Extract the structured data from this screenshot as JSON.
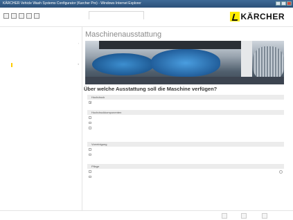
{
  "window": {
    "title": "KÄRCHER Vehicle Wash Systems Configurator (Karcher Pro) - Windows Internet Explorer"
  },
  "toolbar": {
    "tab_label": ""
  },
  "brand": {
    "logo_text": "KÄRCHER",
    "accent": "#ffed00"
  },
  "sidebar": {
    "items": [
      {
        "label": ""
      },
      {
        "label": ""
      },
      {
        "label": ""
      },
      {
        "label": ""
      },
      {
        "label": ""
      },
      {
        "label": ""
      },
      {
        "label": ""
      },
      {
        "label": ""
      },
      {
        "label": ""
      },
      {
        "label": ""
      },
      {
        "label": ""
      },
      {
        "label": ""
      },
      {
        "label": ""
      },
      {
        "label": ""
      },
      {
        "label": ""
      },
      {
        "label": ""
      },
      {
        "label": ""
      },
      {
        "label": ""
      },
      {
        "label": ""
      },
      {
        "label": ""
      },
      {
        "label": ""
      },
      {
        "label": ""
      },
      {
        "label": ""
      }
    ]
  },
  "main": {
    "breadcrumb": "",
    "title": "Maschinenausstattung",
    "question": "Über welche Ausstattung soll die Maschine verfügen?",
    "groups": [
      {
        "title": "Hochdruck",
        "options": [
          {
            "label": "",
            "checked": true
          }
        ]
      },
      {
        "title": "Hochdruckkomponenten",
        "options": [
          {
            "label": "",
            "checked": false
          },
          {
            "label": "",
            "checked": false
          },
          {
            "label": "",
            "checked": false
          }
        ]
      },
      {
        "title": "Vorreinigung",
        "options": [
          {
            "label": "",
            "checked": false
          },
          {
            "label": "",
            "checked": false
          }
        ]
      },
      {
        "title": "Pflege",
        "options": [
          {
            "label": "",
            "checked": false
          },
          {
            "label": "",
            "checked": false
          }
        ]
      }
    ]
  },
  "footer": {
    "language": "",
    "hint": "",
    "back_label": "",
    "next_label": "",
    "finish_label": ""
  }
}
